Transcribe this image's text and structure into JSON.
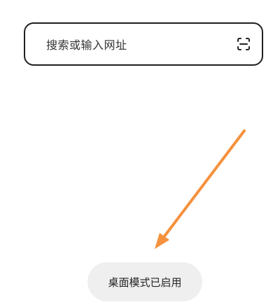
{
  "search": {
    "placeholder": "搜索或输入网址",
    "scan_icon": "scan-icon"
  },
  "toast": {
    "message": "桌面模式已启用"
  },
  "annotation": {
    "arrow_icon": "arrow-icon",
    "arrow_color": "#F5913C"
  },
  "colors": {
    "background": "#FFFFFF",
    "border": "#1F1F1F",
    "toast_background": "#EFEFEF"
  }
}
